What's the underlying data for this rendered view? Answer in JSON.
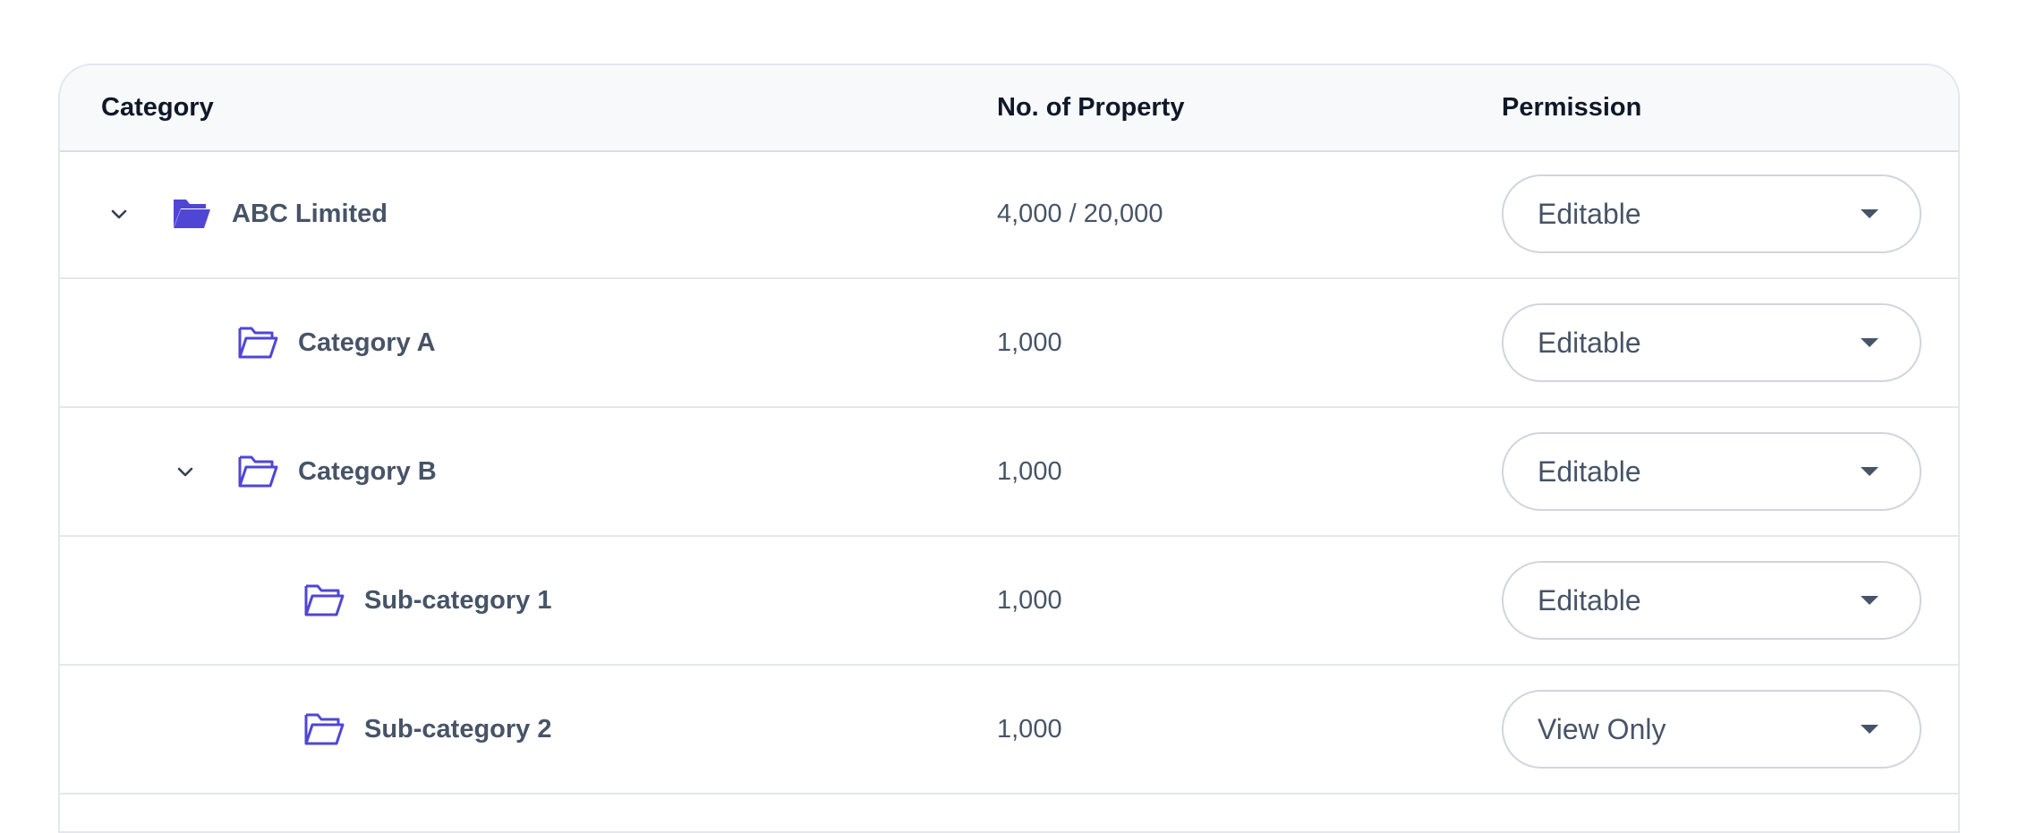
{
  "colors": {
    "accent": "#5046d6",
    "border": "#e4e7ec",
    "header_bg": "#f7f9fa"
  },
  "headers": {
    "category": "Category",
    "count": "No. of Property",
    "permission": "Permission"
  },
  "rows": [
    {
      "name": "ABC Limited",
      "count": "4,000 / 20,000",
      "permission": "Editable",
      "icon": "folder-open-filled-icon",
      "expanded": true,
      "level": 0
    },
    {
      "name": "Category A",
      "count": "1,000",
      "permission": "Editable",
      "icon": "folder-open-outline-icon",
      "expanded": null,
      "level": 1
    },
    {
      "name": "Category B",
      "count": "1,000",
      "permission": "Editable",
      "icon": "folder-open-outline-icon",
      "expanded": true,
      "level": 1
    },
    {
      "name": "Sub-category 1",
      "count": "1,000",
      "permission": "Editable",
      "icon": "folder-open-outline-icon",
      "expanded": null,
      "level": 2
    },
    {
      "name": "Sub-category 2",
      "count": "1,000",
      "permission": "View Only",
      "icon": "folder-open-outline-icon",
      "expanded": null,
      "level": 2
    }
  ]
}
